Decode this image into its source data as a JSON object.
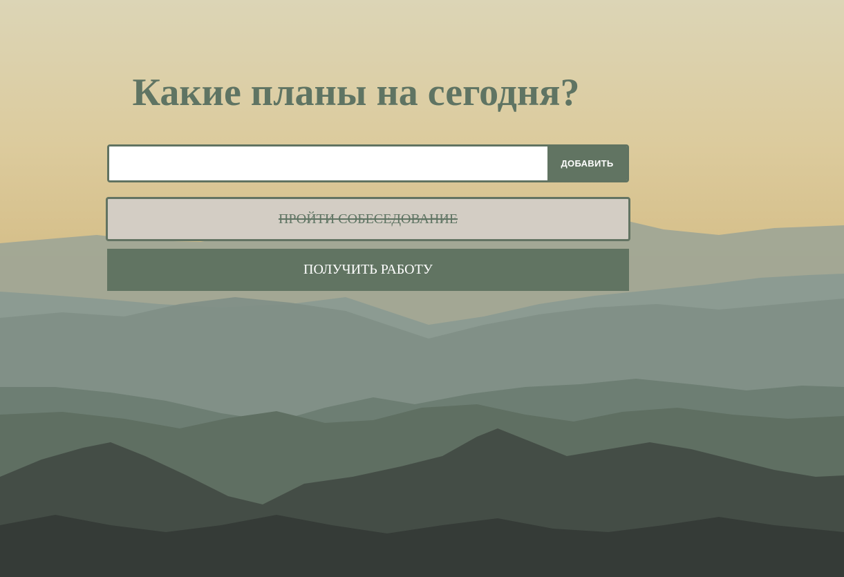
{
  "page": {
    "title": "Какие планы на сегодня?"
  },
  "form": {
    "input_value": "",
    "input_placeholder": "",
    "add_button_label": "ДОБАВИТЬ"
  },
  "todos": [
    {
      "text": "ПРОЙТИ СОБЕСЕДОВАНИЕ",
      "completed": true
    },
    {
      "text": "ПОЛУЧИТЬ РАБОТУ",
      "completed": false
    }
  ],
  "colors": {
    "accent": "#617462",
    "title": "#5f7463",
    "completed_bg": "#d3cdc4"
  }
}
